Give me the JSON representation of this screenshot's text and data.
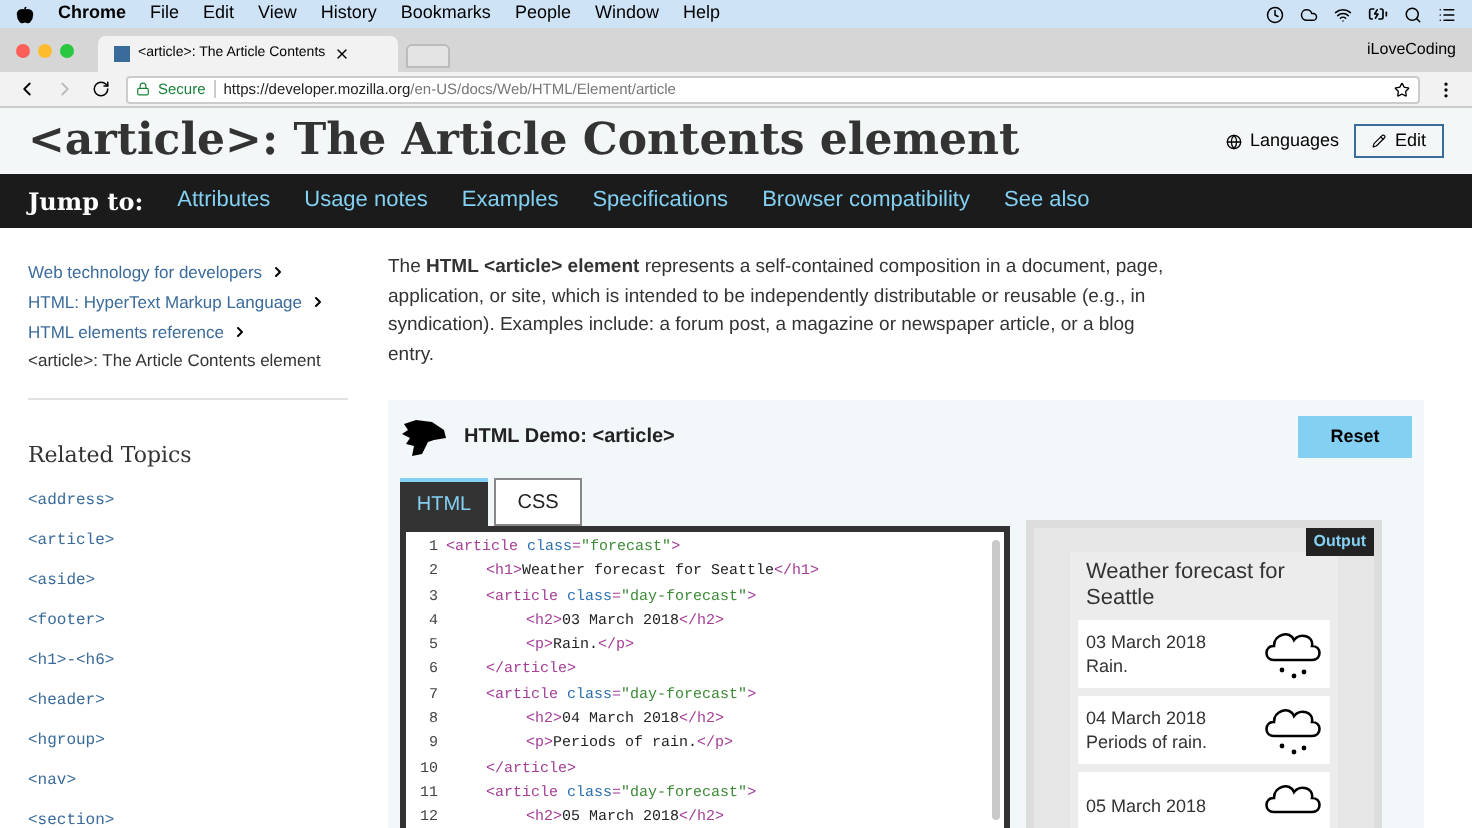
{
  "menu_bar": {
    "app": "Chrome",
    "items": [
      "File",
      "Edit",
      "View",
      "History",
      "Bookmarks",
      "People",
      "Window",
      "Help"
    ]
  },
  "browser": {
    "tab_title": "<article>: The Article Contents",
    "profile": "iLoveCoding",
    "secure_label": "Secure",
    "url_host": "https://developer.mozilla.org",
    "url_path": "/en-US/docs/Web/HTML/Element/article"
  },
  "page_header": {
    "title": "<article>: The Article Contents element",
    "languages": "Languages",
    "edit": "Edit"
  },
  "jump_bar": {
    "label": "Jump to:",
    "links": [
      "Attributes",
      "Usage notes",
      "Examples",
      "Specifications",
      "Browser compatibility",
      "See also"
    ]
  },
  "breadcrumbs": [
    {
      "text": "Web technology for developers",
      "link": true
    },
    {
      "text": "HTML: HyperText Markup Language",
      "link": true
    },
    {
      "text": "HTML elements reference",
      "link": true
    },
    {
      "text": "<article>: The Article Contents element",
      "link": false
    }
  ],
  "related_topics": {
    "title": "Related Topics",
    "items": [
      "<address>",
      "<article>",
      "<aside>",
      "<footer>",
      "<h1>-<h6>",
      "<header>",
      "<hgroup>",
      "<nav>",
      "<section>"
    ]
  },
  "intro": "The **HTML** **<article>** **element** represents a self-contained composition in a document, page, application, or site, which is intended to be independently distributable or reusable (e.g., in syndication). Examples include: a forum post, a magazine or newspaper article, or a blog entry.",
  "demo": {
    "title": "HTML Demo: <article>",
    "reset": "Reset",
    "tabs": [
      {
        "label": "HTML",
        "selected": true
      },
      {
        "label": "CSS",
        "selected": false
      }
    ],
    "code": [
      {
        "num": "1",
        "tokens": [
          {
            "kind": "tag",
            "text": "<article "
          },
          {
            "kind": "attr",
            "text": "class"
          },
          {
            "kind": "tag",
            "text": "="
          },
          {
            "kind": "value",
            "text": "\"forecast\""
          },
          {
            "kind": "tag",
            "text": ">"
          }
        ],
        "children": [
          {
            "num": "2",
            "tokens": [
              {
                "kind": "tag",
                "text": "<h1>"
              },
              {
                "kind": "text",
                "text": "Weather forecast for Seattle"
              },
              {
                "kind": "tag",
                "text": "</h1>"
              }
            ]
          },
          {
            "num": "3",
            "tokens": [
              {
                "kind": "tag",
                "text": "<article "
              },
              {
                "kind": "attr",
                "text": "class"
              },
              {
                "kind": "tag",
                "text": "="
              },
              {
                "kind": "value",
                "text": "\"day-forecast\""
              },
              {
                "kind": "tag",
                "text": ">"
              }
            ],
            "children": [
              {
                "num": "4",
                "tokens": [
                  {
                    "kind": "tag",
                    "text": "<h2>"
                  },
                  {
                    "kind": "text",
                    "text": "03 March 2018"
                  },
                  {
                    "kind": "tag",
                    "text": "</h2>"
                  }
                ]
              },
              {
                "num": "5",
                "tokens": [
                  {
                    "kind": "tag",
                    "text": "<p>"
                  },
                  {
                    "kind": "text",
                    "text": "Rain."
                  },
                  {
                    "kind": "tag",
                    "text": "</p>"
                  }
                ]
              }
            ]
          },
          {
            "num": "6",
            "tokens": [
              {
                "kind": "tag",
                "text": "</article>"
              }
            ]
          },
          {
            "num": "7",
            "tokens": [
              {
                "kind": "tag",
                "text": "<article "
              },
              {
                "kind": "attr",
                "text": "class"
              },
              {
                "kind": "tag",
                "text": "="
              },
              {
                "kind": "value",
                "text": "\"day-forecast\""
              },
              {
                "kind": "tag",
                "text": ">"
              }
            ],
            "children": [
              {
                "num": "8",
                "tokens": [
                  {
                    "kind": "tag",
                    "text": "<h2>"
                  },
                  {
                    "kind": "text",
                    "text": "04 March 2018"
                  },
                  {
                    "kind": "tag",
                    "text": "</h2>"
                  }
                ]
              },
              {
                "num": "9",
                "tokens": [
                  {
                    "kind": "tag",
                    "text": "<p>"
                  },
                  {
                    "kind": "text",
                    "text": "Periods of rain."
                  },
                  {
                    "kind": "tag",
                    "text": "</p>"
                  }
                ]
              }
            ]
          },
          {
            "num": "10",
            "tokens": [
              {
                "kind": "tag",
                "text": "</article>"
              }
            ]
          },
          {
            "num": "11",
            "tokens": [
              {
                "kind": "tag",
                "text": "<article "
              },
              {
                "kind": "attr",
                "text": "class"
              },
              {
                "kind": "tag",
                "text": "="
              },
              {
                "kind": "value",
                "text": "\"day-forecast\""
              },
              {
                "kind": "tag",
                "text": ">"
              }
            ],
            "children": [
              {
                "num": "12",
                "tokens": [
                  {
                    "kind": "tag",
                    "text": "<h2>"
                  },
                  {
                    "kind": "text",
                    "text": "05 March 2018"
                  },
                  {
                    "kind": "tag",
                    "text": "</h2>"
                  }
                ]
              }
            ]
          }
        ]
      }
    ],
    "output": {
      "label": "Output",
      "heading": "Weather forecast for Seattle",
      "days": [
        {
          "date": "03 March 2018",
          "forecast": "Rain."
        },
        {
          "date": "04 March 2018",
          "forecast": "Periods of rain."
        },
        {
          "date": "05 March 2018"
        }
      ]
    }
  }
}
